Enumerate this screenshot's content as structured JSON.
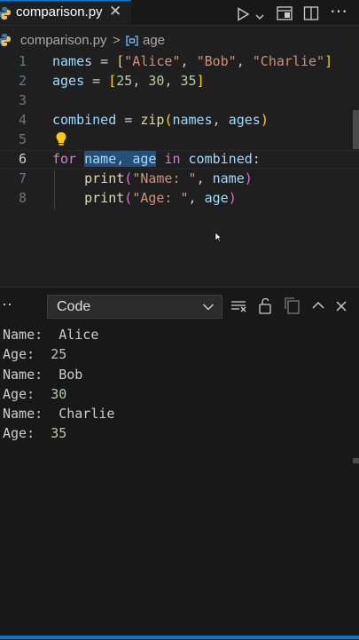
{
  "tab": {
    "filename": "comparison.py",
    "close_glyph": "✕"
  },
  "toolbar": {
    "more_glyph": "⋯"
  },
  "breadcrumb": {
    "file": "comparison.py",
    "separator": ">",
    "symbol": "age"
  },
  "editor": {
    "line_numbers": [
      "1",
      "2",
      "3",
      "4",
      "5",
      "6",
      "7",
      "8"
    ],
    "line1": {
      "v1": "names",
      "eq": " = ",
      "ob": "[",
      "s1": "\"Alice\"",
      "c1": ", ",
      "s2": "\"Bob\"",
      "c2": ", ",
      "s3": "\"Charlie\"",
      "cb": "]"
    },
    "line2": {
      "v1": "ages",
      "eq": " = ",
      "ob": "[",
      "n1": "25",
      "c1": ", ",
      "n2": "30",
      "c2": ", ",
      "n3": "35",
      "cb": "]"
    },
    "line4": {
      "v1": "combined",
      "eq": " = ",
      "fn": "zip",
      "op": "(",
      "a1": "names",
      "c1": ", ",
      "a2": "ages",
      "cp": ")"
    },
    "line6": {
      "kw1": "for",
      "sp1": " ",
      "v1": "name",
      "c1": ", ",
      "v2": "age",
      "sp2": " ",
      "kw2": "in",
      "sp3": " ",
      "v3": "combined",
      "colon": ":"
    },
    "line7": {
      "indent": "    ",
      "fn": "print",
      "op": "(",
      "s1": "\"Name: \"",
      "c1": ", ",
      "v1": "name",
      "cp": ")"
    },
    "line8": {
      "indent": "    ",
      "fn": "print",
      "op": "(",
      "s1": "\"Age: \"",
      "c1": ", ",
      "v1": "age",
      "cp": ")"
    }
  },
  "panel": {
    "more_glyph": "⋯",
    "dropdown": {
      "value": "Code",
      "chevron": "⌄"
    },
    "close_glyph": "✕",
    "collapse_glyph": "⌃",
    "output": [
      {
        "label": "Name:  ",
        "value": "Alice"
      },
      {
        "label": "Age:  ",
        "value": "25"
      },
      {
        "label": "Name:  ",
        "value": "Bob"
      },
      {
        "label": "Age:  ",
        "value": "30"
      },
      {
        "label": "Name:  ",
        "value": "Charlie"
      },
      {
        "label": "Age:  ",
        "value": "35"
      }
    ]
  },
  "colors": {
    "accent": "#0078d4",
    "editor_bg": "#1f1f1f",
    "panel_bg": "#181818"
  }
}
